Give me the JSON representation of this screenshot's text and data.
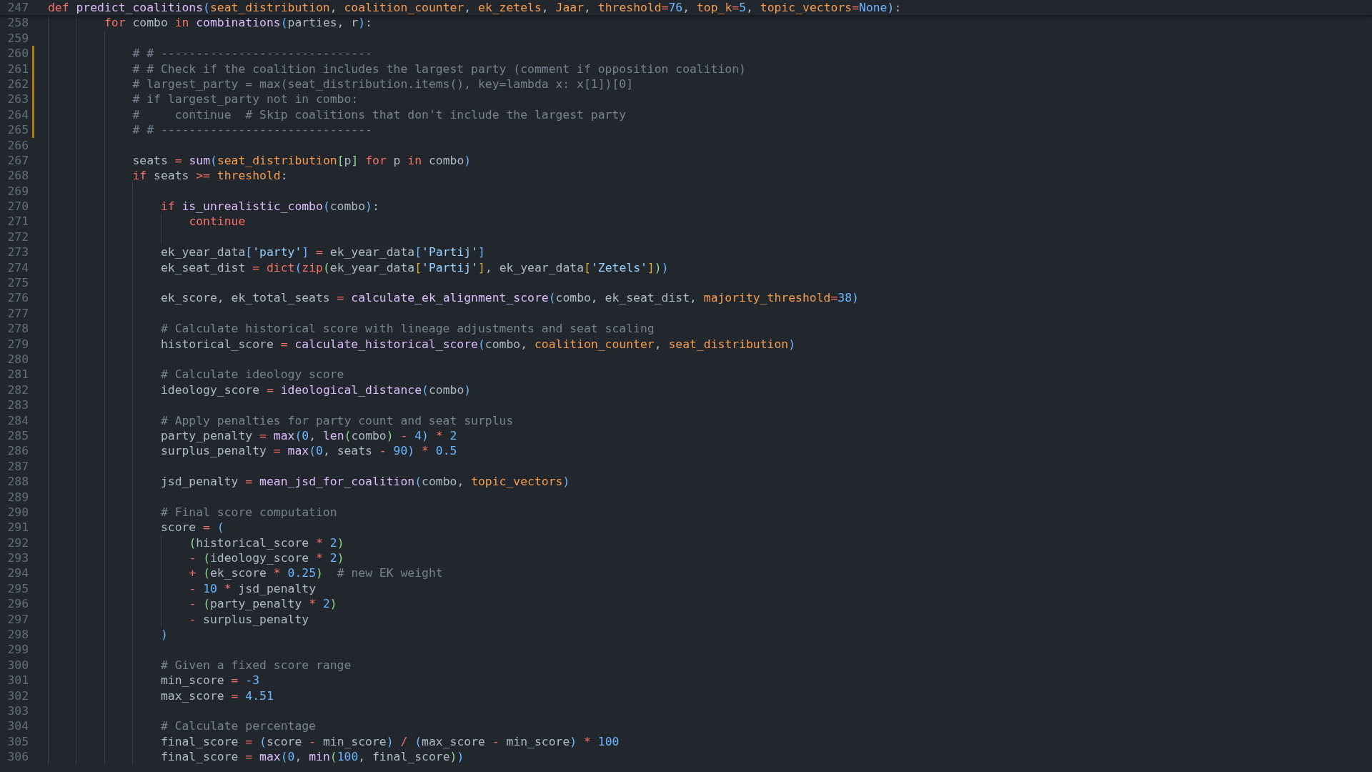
{
  "sticky_header": {
    "number": "247",
    "modified": false,
    "tokens": [
      {
        "kind": "keyword",
        "text": "def "
      },
      {
        "kind": "function",
        "text": "predict_coalitions"
      },
      {
        "kind": "outer",
        "text": "("
      },
      {
        "kind": "param",
        "text": "seat_distribution"
      },
      {
        "kind": "text",
        "text": ", "
      },
      {
        "kind": "param",
        "text": "coalition_counter"
      },
      {
        "kind": "text",
        "text": ", "
      },
      {
        "kind": "param",
        "text": "ek_zetels"
      },
      {
        "kind": "text",
        "text": ", "
      },
      {
        "kind": "param",
        "text": "Jaar"
      },
      {
        "kind": "text",
        "text": ", "
      },
      {
        "kind": "param",
        "text": "threshold"
      },
      {
        "kind": "operator",
        "text": "="
      },
      {
        "kind": "number",
        "text": "76"
      },
      {
        "kind": "text",
        "text": ", "
      },
      {
        "kind": "param",
        "text": "top_k"
      },
      {
        "kind": "operator",
        "text": "="
      },
      {
        "kind": "number",
        "text": "5"
      },
      {
        "kind": "text",
        "text": ", "
      },
      {
        "kind": "param",
        "text": "topic_vectors"
      },
      {
        "kind": "operator",
        "text": "="
      },
      {
        "kind": "number",
        "text": "None"
      },
      {
        "kind": "outer",
        "text": ")"
      },
      {
        "kind": "text",
        "text": ":"
      }
    ]
  },
  "lines": [
    {
      "number": "258",
      "modified": false,
      "tokens": [
        {
          "kind": "keyword",
          "text": "        for"
        },
        {
          "kind": "text",
          "text": " combo "
        },
        {
          "kind": "keyword",
          "text": "in "
        },
        {
          "kind": "function",
          "text": "combinations"
        },
        {
          "kind": "outer",
          "text": "("
        },
        {
          "kind": "text",
          "text": "parties, r"
        },
        {
          "kind": "outer",
          "text": ")"
        },
        {
          "kind": "text",
          "text": ":"
        }
      ]
    },
    {
      "number": "259",
      "modified": false
    },
    {
      "number": "260",
      "modified": true,
      "tokens": [
        {
          "kind": "comment",
          "text": "            # # ------------------------------"
        }
      ]
    },
    {
      "number": "261",
      "modified": true,
      "tokens": [
        {
          "kind": "comment",
          "text": "            # # Check if the coalition includes the largest party (comment if opposition coalition)"
        }
      ]
    },
    {
      "number": "262",
      "modified": true,
      "tokens": [
        {
          "kind": "comment",
          "text": "            # largest_party = max(seat_distribution.items(), key=lambda x: x[1])[0]"
        }
      ]
    },
    {
      "number": "263",
      "modified": true,
      "tokens": [
        {
          "kind": "comment",
          "text": "            # if largest_party not in combo:"
        }
      ]
    },
    {
      "number": "264",
      "modified": true,
      "tokens": [
        {
          "kind": "comment",
          "text": "            #     continue  # Skip coalitions that don't include the largest party"
        }
      ]
    },
    {
      "number": "265",
      "modified": true,
      "tokens": [
        {
          "kind": "comment",
          "text": "            # # ------------------------------"
        }
      ]
    },
    {
      "number": "266",
      "modified": false
    },
    {
      "number": "267",
      "modified": false,
      "tokens": [
        {
          "kind": "text",
          "text": "            seats "
        },
        {
          "kind": "operator",
          "text": "= "
        },
        {
          "kind": "function",
          "text": "sum"
        },
        {
          "kind": "outer",
          "text": "("
        },
        {
          "kind": "param",
          "text": "seat_distribution"
        },
        {
          "kind": "inner",
          "text": "["
        },
        {
          "kind": "text",
          "text": "p"
        },
        {
          "kind": "inner",
          "text": "] "
        },
        {
          "kind": "keyword",
          "text": "for"
        },
        {
          "kind": "text",
          "text": " p "
        },
        {
          "kind": "keyword",
          "text": "in"
        },
        {
          "kind": "text",
          "text": " combo"
        },
        {
          "kind": "outer",
          "text": ")"
        }
      ]
    },
    {
      "number": "268",
      "modified": false,
      "tokens": [
        {
          "kind": "keyword",
          "text": "            if"
        },
        {
          "kind": "text",
          "text": " seats "
        },
        {
          "kind": "operator",
          "text": ">= "
        },
        {
          "kind": "param",
          "text": "threshold"
        },
        {
          "kind": "text",
          "text": ":"
        }
      ]
    },
    {
      "number": "269",
      "modified": false
    },
    {
      "number": "270",
      "modified": false,
      "tokens": [
        {
          "kind": "keyword",
          "text": "                if "
        },
        {
          "kind": "function",
          "text": "is_unrealistic_combo"
        },
        {
          "kind": "outer",
          "text": "("
        },
        {
          "kind": "text",
          "text": "combo"
        },
        {
          "kind": "outer",
          "text": ")"
        },
        {
          "kind": "text",
          "text": ":"
        }
      ]
    },
    {
      "number": "271",
      "modified": false,
      "tokens": [
        {
          "kind": "keyword",
          "text": "                    continue"
        }
      ]
    },
    {
      "number": "272",
      "modified": false
    },
    {
      "number": "273",
      "modified": false,
      "tokens": [
        {
          "kind": "text",
          "text": "                ek_year_data"
        },
        {
          "kind": "outer",
          "text": "["
        },
        {
          "kind": "string",
          "text": "'party'"
        },
        {
          "kind": "outer",
          "text": "] "
        },
        {
          "kind": "operator",
          "text": "="
        },
        {
          "kind": "text",
          "text": " ek_year_data"
        },
        {
          "kind": "outer",
          "text": "["
        },
        {
          "kind": "string",
          "text": "'Partij'"
        },
        {
          "kind": "outer",
          "text": "]"
        }
      ]
    },
    {
      "number": "274",
      "modified": false,
      "tokens": [
        {
          "kind": "text",
          "text": "                ek_seat_dist "
        },
        {
          "kind": "operator",
          "text": "= "
        },
        {
          "kind": "keyword",
          "text": "dict"
        },
        {
          "kind": "outer",
          "text": "("
        },
        {
          "kind": "keyword",
          "text": "zip"
        },
        {
          "kind": "inner",
          "text": "("
        },
        {
          "kind": "text",
          "text": "ek_year_data"
        },
        {
          "kind": "innermost",
          "text": "["
        },
        {
          "kind": "string",
          "text": "'Partij'"
        },
        {
          "kind": "innermost",
          "text": "]"
        },
        {
          "kind": "text",
          "text": ", ek_year_data"
        },
        {
          "kind": "innermost",
          "text": "["
        },
        {
          "kind": "string",
          "text": "'Zetels'"
        },
        {
          "kind": "innermost",
          "text": "]"
        },
        {
          "kind": "inner",
          "text": ")"
        },
        {
          "kind": "outer",
          "text": ")"
        }
      ]
    },
    {
      "number": "275",
      "modified": false
    },
    {
      "number": "276",
      "modified": false,
      "tokens": [
        {
          "kind": "text",
          "text": "                ek_score, ek_total_seats "
        },
        {
          "kind": "operator",
          "text": "= "
        },
        {
          "kind": "function",
          "text": "calculate_ek_alignment_score"
        },
        {
          "kind": "outer",
          "text": "("
        },
        {
          "kind": "text",
          "text": "combo, ek_seat_dist, "
        },
        {
          "kind": "param",
          "text": "majority_threshold"
        },
        {
          "kind": "operator",
          "text": "="
        },
        {
          "kind": "number",
          "text": "38"
        },
        {
          "kind": "outer",
          "text": ")"
        }
      ]
    },
    {
      "number": "277",
      "modified": false
    },
    {
      "number": "278",
      "modified": false,
      "tokens": [
        {
          "kind": "comment",
          "text": "                # Calculate historical score with lineage adjustments and seat scaling"
        }
      ]
    },
    {
      "number": "279",
      "modified": false,
      "tokens": [
        {
          "kind": "text",
          "text": "                historical_score "
        },
        {
          "kind": "operator",
          "text": "= "
        },
        {
          "kind": "function",
          "text": "calculate_historical_score"
        },
        {
          "kind": "outer",
          "text": "("
        },
        {
          "kind": "text",
          "text": "combo, "
        },
        {
          "kind": "param",
          "text": "coalition_counter"
        },
        {
          "kind": "text",
          "text": ", "
        },
        {
          "kind": "param",
          "text": "seat_distribution"
        },
        {
          "kind": "outer",
          "text": ")"
        }
      ]
    },
    {
      "number": "280",
      "modified": false
    },
    {
      "number": "281",
      "modified": false,
      "tokens": [
        {
          "kind": "comment",
          "text": "                # Calculate ideology score"
        }
      ]
    },
    {
      "number": "282",
      "modified": false,
      "tokens": [
        {
          "kind": "text",
          "text": "                ideology_score "
        },
        {
          "kind": "operator",
          "text": "= "
        },
        {
          "kind": "function",
          "text": "ideological_distance"
        },
        {
          "kind": "outer",
          "text": "("
        },
        {
          "kind": "text",
          "text": "combo"
        },
        {
          "kind": "outer",
          "text": ")"
        }
      ]
    },
    {
      "number": "283",
      "modified": false
    },
    {
      "number": "284",
      "modified": false,
      "tokens": [
        {
          "kind": "comment",
          "text": "                # Apply penalties for party count and seat surplus"
        }
      ]
    },
    {
      "number": "285",
      "modified": false,
      "tokens": [
        {
          "kind": "text",
          "text": "                party_penalty "
        },
        {
          "kind": "operator",
          "text": "= "
        },
        {
          "kind": "function",
          "text": "max"
        },
        {
          "kind": "outer",
          "text": "("
        },
        {
          "kind": "number",
          "text": "0"
        },
        {
          "kind": "text",
          "text": ", "
        },
        {
          "kind": "function",
          "text": "len"
        },
        {
          "kind": "inner",
          "text": "("
        },
        {
          "kind": "text",
          "text": "combo"
        },
        {
          "kind": "inner",
          "text": ") "
        },
        {
          "kind": "operator",
          "text": "- "
        },
        {
          "kind": "number",
          "text": "4"
        },
        {
          "kind": "outer",
          "text": ") "
        },
        {
          "kind": "operator",
          "text": "* "
        },
        {
          "kind": "number",
          "text": "2"
        }
      ]
    },
    {
      "number": "286",
      "modified": false,
      "tokens": [
        {
          "kind": "text",
          "text": "                surplus_penalty "
        },
        {
          "kind": "operator",
          "text": "= "
        },
        {
          "kind": "function",
          "text": "max"
        },
        {
          "kind": "outer",
          "text": "("
        },
        {
          "kind": "number",
          "text": "0"
        },
        {
          "kind": "text",
          "text": ", seats "
        },
        {
          "kind": "operator",
          "text": "- "
        },
        {
          "kind": "number",
          "text": "90"
        },
        {
          "kind": "outer",
          "text": ") "
        },
        {
          "kind": "operator",
          "text": "* "
        },
        {
          "kind": "number",
          "text": "0.5"
        }
      ]
    },
    {
      "number": "287",
      "modified": false
    },
    {
      "number": "288",
      "modified": false,
      "tokens": [
        {
          "kind": "text",
          "text": "                jsd_penalty "
        },
        {
          "kind": "operator",
          "text": "= "
        },
        {
          "kind": "function",
          "text": "mean_jsd_for_coalition"
        },
        {
          "kind": "outer",
          "text": "("
        },
        {
          "kind": "text",
          "text": "combo, "
        },
        {
          "kind": "param",
          "text": "topic_vectors"
        },
        {
          "kind": "outer",
          "text": ")"
        }
      ]
    },
    {
      "number": "289",
      "modified": false
    },
    {
      "number": "290",
      "modified": false,
      "tokens": [
        {
          "kind": "comment",
          "text": "                # Final score computation"
        }
      ]
    },
    {
      "number": "291",
      "modified": false,
      "tokens": [
        {
          "kind": "text",
          "text": "                score "
        },
        {
          "kind": "operator",
          "text": "= "
        },
        {
          "kind": "outer",
          "text": "("
        }
      ]
    },
    {
      "number": "292",
      "modified": false,
      "tokens": [
        {
          "kind": "inner",
          "text": "                    ("
        },
        {
          "kind": "text",
          "text": "historical_score "
        },
        {
          "kind": "operator",
          "text": "* "
        },
        {
          "kind": "number",
          "text": "2"
        },
        {
          "kind": "inner",
          "text": ")"
        }
      ]
    },
    {
      "number": "293",
      "modified": false,
      "tokens": [
        {
          "kind": "operator",
          "text": "                    - "
        },
        {
          "kind": "inner",
          "text": "("
        },
        {
          "kind": "text",
          "text": "ideology_score "
        },
        {
          "kind": "operator",
          "text": "* "
        },
        {
          "kind": "number",
          "text": "2"
        },
        {
          "kind": "inner",
          "text": ")"
        }
      ]
    },
    {
      "number": "294",
      "modified": false,
      "tokens": [
        {
          "kind": "operator",
          "text": "                    + "
        },
        {
          "kind": "inner",
          "text": "("
        },
        {
          "kind": "text",
          "text": "ek_score "
        },
        {
          "kind": "operator",
          "text": "* "
        },
        {
          "kind": "number",
          "text": "0.25"
        },
        {
          "kind": "inner",
          "text": ")  "
        },
        {
          "kind": "comment",
          "text": "# new EK weight"
        }
      ]
    },
    {
      "number": "295",
      "modified": false,
      "tokens": [
        {
          "kind": "operator",
          "text": "                    - "
        },
        {
          "kind": "number",
          "text": "10 "
        },
        {
          "kind": "operator",
          "text": "*"
        },
        {
          "kind": "text",
          "text": " jsd_penalty"
        }
      ]
    },
    {
      "number": "296",
      "modified": false,
      "tokens": [
        {
          "kind": "operator",
          "text": "                    - "
        },
        {
          "kind": "inner",
          "text": "("
        },
        {
          "kind": "text",
          "text": "party_penalty "
        },
        {
          "kind": "operator",
          "text": "* "
        },
        {
          "kind": "number",
          "text": "2"
        },
        {
          "kind": "inner",
          "text": ")"
        }
      ]
    },
    {
      "number": "297",
      "modified": false,
      "tokens": [
        {
          "kind": "operator",
          "text": "                    -"
        },
        {
          "kind": "text",
          "text": " surplus_penalty"
        }
      ]
    },
    {
      "number": "298",
      "modified": false,
      "tokens": [
        {
          "kind": "outer",
          "text": "                )"
        }
      ]
    },
    {
      "number": "299",
      "modified": false
    },
    {
      "number": "300",
      "modified": false,
      "tokens": [
        {
          "kind": "comment",
          "text": "                # Given a fixed score range"
        }
      ]
    },
    {
      "number": "301",
      "modified": false,
      "tokens": [
        {
          "kind": "text",
          "text": "                min_score "
        },
        {
          "kind": "operator",
          "text": "= "
        },
        {
          "kind": "number",
          "text": "-3"
        }
      ]
    },
    {
      "number": "302",
      "modified": false,
      "tokens": [
        {
          "kind": "text",
          "text": "                max_score "
        },
        {
          "kind": "operator",
          "text": "= "
        },
        {
          "kind": "number",
          "text": "4.51"
        }
      ]
    },
    {
      "number": "303",
      "modified": false
    },
    {
      "number": "304",
      "modified": false,
      "tokens": [
        {
          "kind": "comment",
          "text": "                # Calculate percentage"
        }
      ]
    },
    {
      "number": "305",
      "modified": false,
      "tokens": [
        {
          "kind": "text",
          "text": "                final_score "
        },
        {
          "kind": "operator",
          "text": "= "
        },
        {
          "kind": "outer",
          "text": "("
        },
        {
          "kind": "text",
          "text": "score "
        },
        {
          "kind": "operator",
          "text": "-"
        },
        {
          "kind": "text",
          "text": " min_score"
        },
        {
          "kind": "outer",
          "text": ") "
        },
        {
          "kind": "operator",
          "text": "/ "
        },
        {
          "kind": "outer",
          "text": "("
        },
        {
          "kind": "text",
          "text": "max_score "
        },
        {
          "kind": "operator",
          "text": "-"
        },
        {
          "kind": "text",
          "text": " min_score"
        },
        {
          "kind": "outer",
          "text": ") "
        },
        {
          "kind": "operator",
          "text": "* "
        },
        {
          "kind": "number",
          "text": "100"
        }
      ]
    },
    {
      "number": "306",
      "modified": false,
      "tokens": [
        {
          "kind": "text",
          "text": "                final_score "
        },
        {
          "kind": "operator",
          "text": "= "
        },
        {
          "kind": "function",
          "text": "max"
        },
        {
          "kind": "outer",
          "text": "("
        },
        {
          "kind": "number",
          "text": "0"
        },
        {
          "kind": "text",
          "text": ", "
        },
        {
          "kind": "function",
          "text": "min"
        },
        {
          "kind": "inner",
          "text": "("
        },
        {
          "kind": "number",
          "text": "100"
        },
        {
          "kind": "text",
          "text": ", final_score"
        },
        {
          "kind": "inner",
          "text": ")"
        },
        {
          "kind": "outer",
          "text": ")"
        }
      ]
    }
  ]
}
